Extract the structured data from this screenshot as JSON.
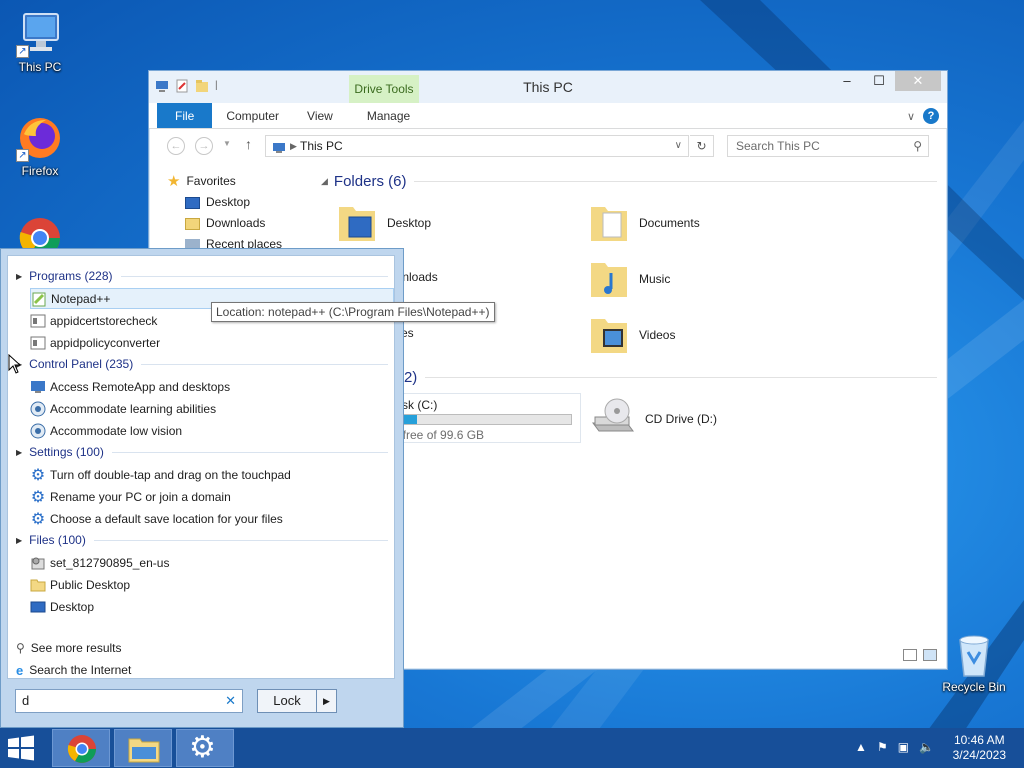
{
  "desktop": {
    "icons": [
      {
        "label": "This PC",
        "icon": "computer-icon"
      },
      {
        "label": "Firefox",
        "icon": "firefox-icon"
      },
      {
        "label": "Recycle Bin",
        "icon": "recycle-bin-icon"
      }
    ]
  },
  "explorer": {
    "title": "This PC",
    "contextual_tab": "Drive Tools",
    "tabs": [
      "File",
      "Computer",
      "View",
      "Manage"
    ],
    "address": "This PC",
    "search_placeholder": "Search This PC",
    "nav": {
      "favorites": "Favorites",
      "items": [
        "Desktop",
        "Downloads",
        "Recent places"
      ]
    },
    "folders_header": "Folders (6)",
    "folders": [
      "Desktop",
      "Documents",
      "ownloads",
      "Music",
      "tures",
      "Videos"
    ],
    "drives_header": "nd drives (2)",
    "drives": [
      {
        "name": "cal Disk (C:)",
        "free": "5 GB free of 99.6 GB",
        "used_fraction": 0.22
      },
      {
        "name": "CD Drive (D:)"
      }
    ]
  },
  "search_pane": {
    "categories": [
      {
        "label": "Programs (228)",
        "items": [
          "Notepad++",
          "appidcertstorecheck",
          "appidpolicyconverter"
        ]
      },
      {
        "label": "Control Panel (235)",
        "items": [
          "Access RemoteApp and desktops",
          "Accommodate learning abilities",
          "Accommodate low vision"
        ]
      },
      {
        "label": "Settings (100)",
        "items": [
          "Turn off double-tap and drag on the touchpad",
          "Rename your PC or join a domain",
          "Choose a default save location for your files"
        ]
      },
      {
        "label": "Files (100)",
        "items": [
          "set_812790895_en-us",
          "Public Desktop",
          "Desktop"
        ]
      }
    ],
    "see_more": "See more results",
    "search_internet": "Search the Internet",
    "query": "d",
    "lock_label": "Lock",
    "tooltip": "Location: notepad++ (C:\\Program Files\\Notepad++)"
  },
  "taskbar": {
    "apps": [
      "chrome-icon",
      "file-explorer-icon",
      "settings-icon"
    ],
    "time": "10:46 AM",
    "date": "3/24/2023"
  },
  "colors": {
    "accent": "#1979ca",
    "taskbar": "#174f99",
    "category_text": "#1e3287"
  }
}
